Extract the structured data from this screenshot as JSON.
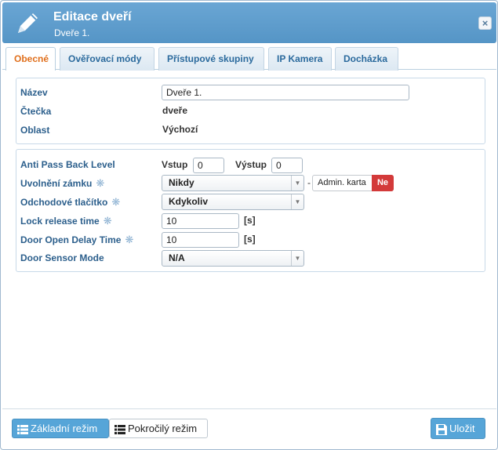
{
  "header": {
    "title": "Editace dveří",
    "subtitle": "Dveře 1.",
    "close_glyph": "×",
    "color": "#5b9bcb"
  },
  "tabs": [
    {
      "label": "Obecné",
      "active": true
    },
    {
      "label": "Ověřovací módy",
      "active": false
    },
    {
      "label": "Přístupové skupiny",
      "active": false
    },
    {
      "label": "IP Kamera",
      "active": false
    },
    {
      "label": "Docházka",
      "active": false
    }
  ],
  "general": {
    "name_label": "Název",
    "name_value": "Dveře 1.",
    "reader_label": "Čtečka",
    "reader_value": "dveře",
    "area_label": "Oblast",
    "area_value": "Výchozí"
  },
  "settings": {
    "apb_label": "Anti Pass Back Level",
    "apb_in_label": "Vstup",
    "apb_in_value": "0",
    "apb_out_label": "Výstup",
    "apb_out_value": "0",
    "lock_release_label": "Uvolnění zámku",
    "lock_release_value": "Nikdy",
    "lock_release_dash": "-",
    "admin_card_label": "Admin. karta",
    "admin_card_toggle": "Ne",
    "exit_button_label": "Odchodové tlačítko",
    "exit_button_value": "Kdykoliv",
    "lock_time_label": "Lock release time",
    "lock_time_value": "10",
    "lock_time_unit": "[s]",
    "door_delay_label": "Door Open Delay Time",
    "door_delay_value": "10",
    "door_delay_unit": "[s]",
    "door_sensor_label": "Door Sensor Mode",
    "door_sensor_value": "N/A"
  },
  "footer": {
    "basic_mode_label": "Základní režim",
    "advanced_mode_label": "Pokročilý režim",
    "save_label": "Uložit"
  },
  "colors": {
    "accent": "#56a5d8",
    "active_tab": "#e06f1c",
    "label": "#2c5f8c",
    "toggle_no": "#d33a3a"
  },
  "icons": {
    "header": "pencil-icon",
    "basic_mode": "list-icon",
    "advanced_mode": "list-icon",
    "save": "floppy-disk-icon"
  }
}
